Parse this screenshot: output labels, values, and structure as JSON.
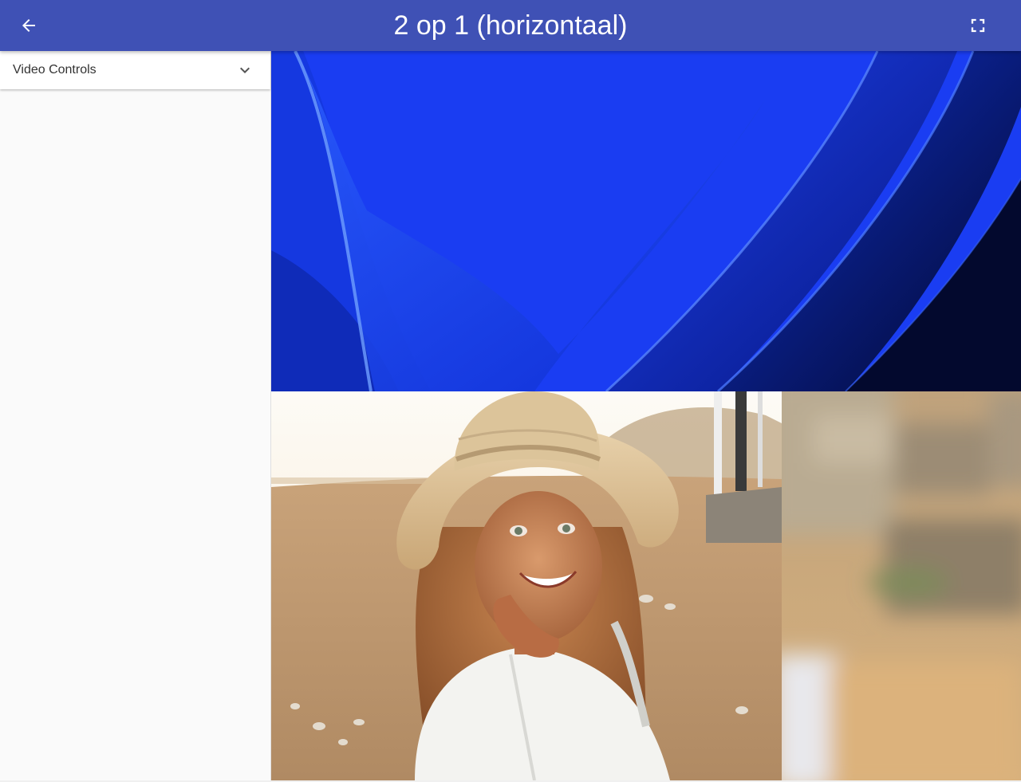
{
  "appbar": {
    "title": "2 op 1 (horizontaal)",
    "back_icon": "arrow-back-icon",
    "fullscreen_icon": "fullscreen-icon",
    "color": "#3f51b5"
  },
  "sidebar": {
    "accordion": {
      "label": "Video Controls",
      "icon": "chevron-down-icon",
      "expanded": false
    }
  },
  "video": {
    "layout": "2 op 1 (horizontaal)",
    "feeds": [
      {
        "name": "top-feed",
        "content": "blue abstract wallpaper"
      },
      {
        "name": "bottom-feed-main",
        "content": "girl in straw hat on beach"
      },
      {
        "name": "bottom-feed-side",
        "content": "blurred beach background"
      }
    ]
  }
}
